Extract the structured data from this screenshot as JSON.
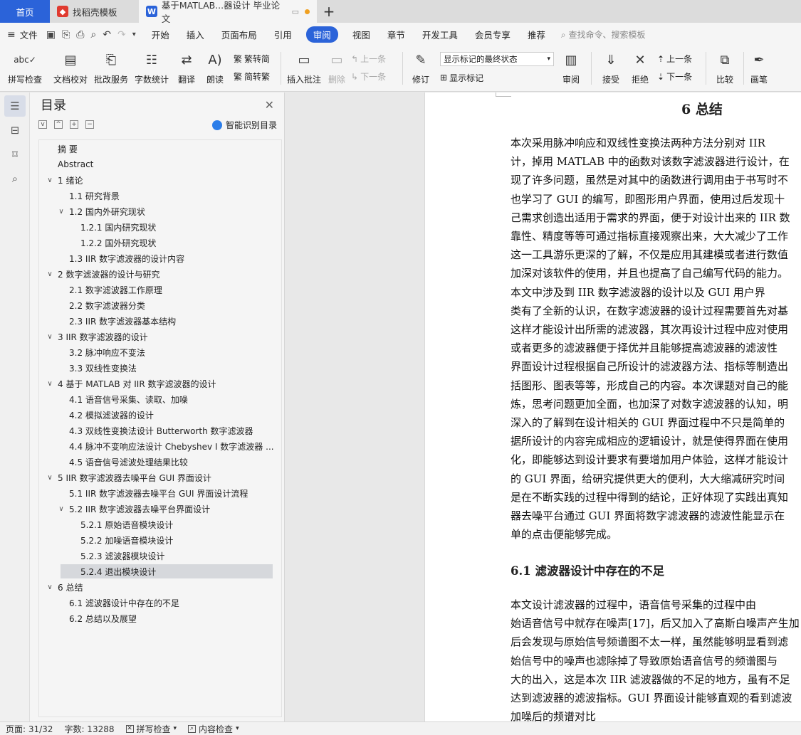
{
  "tabs": [
    {
      "label": "首页"
    },
    {
      "label": "找稻壳模板"
    },
    {
      "label": "基于MATLAB...器设计 毕业论文"
    }
  ],
  "menu": {
    "file": "文件",
    "items": [
      "开始",
      "插入",
      "页面布局",
      "引用",
      "审阅",
      "视图",
      "章节",
      "开发工具",
      "会员专享",
      "推荐"
    ],
    "active": "审阅",
    "search": "查找命令、搜索模板"
  },
  "ribbon": {
    "spellcheck": "拼写检查",
    "doc_check": "文档校对",
    "review_service": "批改服务",
    "word_count": "字数统计",
    "translate": "翻译",
    "read_aloud": "朗读",
    "to_traditional": "繁转简",
    "to_simplified": "简转繁",
    "insert_comment": "插入批注",
    "delete": "删除",
    "prev": "上一条",
    "next": "下一条",
    "revise": "修订",
    "markup_select": "显示标记的最终状态",
    "show_markup": "显示标记",
    "review": "审阅",
    "accept": "接受",
    "reject": "拒绝",
    "prev2": "上一条",
    "next2": "下一条",
    "compare": "比较",
    "pen": "画笔"
  },
  "toc": {
    "title": "目录",
    "smart": "智能识别目录",
    "items": [
      {
        "label": "摘    要",
        "level": 0,
        "chev": ""
      },
      {
        "label": "Abstract",
        "level": 0,
        "chev": ""
      },
      {
        "label": "1  绪论",
        "level": 0,
        "chev": "v"
      },
      {
        "label": "1.1    研究背景",
        "level": 1,
        "chev": ""
      },
      {
        "label": "1.2    国内外研究现状",
        "level": 1,
        "chev": "v"
      },
      {
        "label": "1.2.1    国内研究现状",
        "level": 2,
        "chev": ""
      },
      {
        "label": "1.2.2    国外研究现状",
        "level": 2,
        "chev": ""
      },
      {
        "label": "1.3    IIR 数字滤波器的设计内容",
        "level": 1,
        "chev": ""
      },
      {
        "label": "2   数字滤波器的设计与研究",
        "level": 0,
        "chev": "v"
      },
      {
        "label": "2.1    数字滤波器工作原理",
        "level": 1,
        "chev": ""
      },
      {
        "label": "2.2    数字滤波器分类",
        "level": 1,
        "chev": ""
      },
      {
        "label": "2.3    IIR 数字滤波器基本结构",
        "level": 1,
        "chev": ""
      },
      {
        "label": "3   IIR 数字滤波器的设计",
        "level": 0,
        "chev": "v"
      },
      {
        "label": "3.2    脉冲响应不变法",
        "level": 1,
        "chev": ""
      },
      {
        "label": "3.3    双线性变换法",
        "level": 1,
        "chev": ""
      },
      {
        "label": "4   基于 MATLAB 对 IIR 数字滤波器的设计",
        "level": 0,
        "chev": "v"
      },
      {
        "label": "4.1    语音信号采集、读取、加噪",
        "level": 1,
        "chev": ""
      },
      {
        "label": "4.2    模拟滤波器的设计",
        "level": 1,
        "chev": ""
      },
      {
        "label": "4.3    双线性变换法设计 Butterworth 数字滤波器",
        "level": 1,
        "chev": ""
      },
      {
        "label": "4.4    脉冲不变响应法设计 Chebyshev I 数字滤波器 ...",
        "level": 1,
        "chev": ""
      },
      {
        "label": "4.5    语音信号滤波处理结果比较",
        "level": 1,
        "chev": ""
      },
      {
        "label": "5   IIR 数字滤波器去噪平台 GUI 界面设计",
        "level": 0,
        "chev": "v"
      },
      {
        "label": "5.1    IIR 数字滤波器去噪平台 GUI 界面设计流程",
        "level": 1,
        "chev": ""
      },
      {
        "label": "5.2    IIR 数字滤波器去噪平台界面设计",
        "level": 1,
        "chev": "v"
      },
      {
        "label": "5.2.1    原始语音模块设计",
        "level": 2,
        "chev": ""
      },
      {
        "label": "5.2.2    加噪语音模块设计",
        "level": 2,
        "chev": ""
      },
      {
        "label": "5.2.3    滤波器模块设计",
        "level": 2,
        "chev": ""
      },
      {
        "label": "5.2.4    退出模块设计",
        "level": 2,
        "chev": "",
        "selected": true
      },
      {
        "label": "6   总结",
        "level": 0,
        "chev": "v"
      },
      {
        "label": "6.1    滤波器设计中存在的不足",
        "level": 1,
        "chev": ""
      },
      {
        "label": "6.2    总结以及展望",
        "level": 1,
        "chev": ""
      }
    ]
  },
  "document": {
    "h1": "6    总结",
    "h2": "6.1    滤波器设计中存在的不足",
    "lines": [
      "        本次采用脉冲响应和双线性变换法两种方法分别对 IIR",
      "计，掉用 MATLAB 中的函数对该数字滤波器进行设计，在",
      "现了许多问题，虽然是对其中的函数进行调用由于书写时不",
      "也学习了 GUI 的编写，即图形用户界面，使用过后发现十",
      "己需求创造出适用于需求的界面，便于对设计出来的 IIR 数",
      "靠性、精度等等可通过指标直接观察出来，大大减少了工作",
      "这一工具游乐更深的了解，不仅是应用其建模或者进行数值",
      "加深对该软件的使用，并且也提高了自己编写代码的能力。",
      "        本文中涉及到 IIR 数字滤波器的设计以及 GUI 用户界",
      "类有了全新的认识，在数字滤波器的设计过程需要首先对基",
      "这样才能设计出所需的滤波器，其次再设计过程中应对使用",
      "或者更多的滤波器便于择优并且能够提高滤波器的滤波性",
      "界面设计过程根据自己所设计的滤波器方法、指标等制造出",
      "括图形、图表等等，形成自己的内容。本次课题对自己的能",
      "炼，思考问题更加全面，也加深了对数字滤波器的认知，明",
      "深入的了解到在设计相关的 GUI 界面过程中不只是简单的",
      "据所设计的内容完成相应的逻辑设计，就是使得界面在使用",
      "化，即能够达到设计要求有要增加用户体验，这样才能设计",
      "的 GUI 界面，给研究提供更大的便利，大大缩减研究时间",
      "是在不断实践的过程中得到的结论，正好体现了实践出真知",
      "器去噪平台通过 GUI 界面将数字滤波器的滤波性能显示在",
      "单的点击便能够完成。"
    ],
    "lines2": [
      "        本文设计滤波器的过程中，语音信号采集的过程中由",
      "始语音信号中就存在噪声[17]，后又加入了高斯白噪声产生加",
      "后会发现与原始信号频谱图不太一样，虽然能够明显看到滤",
      "始信号中的噪声也滤除掉了导致原始语音信号的频谱图与",
      "大的出入，这是本次 IIR 滤波器做的不足的地方，虽有不足",
      "达到滤波器的滤波指标。GUI 界面设计能够直观的看到滤波",
      "加噪后的频谱对比"
    ]
  },
  "status": {
    "page": "页面: 31/32",
    "words": "字数: 13288",
    "spell": "拼写检查",
    "content": "内容检查"
  }
}
